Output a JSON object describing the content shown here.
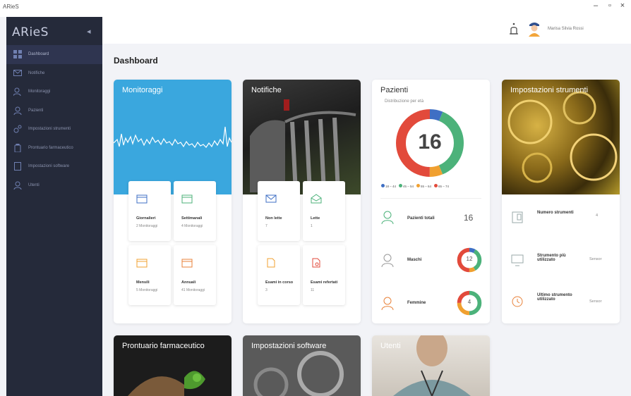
{
  "window": {
    "title": "ARieS",
    "minimize": "–",
    "maximize": "▫",
    "close": "×"
  },
  "sidebar": {
    "brand": "ARieS",
    "collapse": "◂",
    "items": [
      {
        "label": "Dashboard"
      },
      {
        "label": "Notifiche"
      },
      {
        "label": "Monitoraggi"
      },
      {
        "label": "Pazienti"
      },
      {
        "label": "Impostazioni strumenti"
      },
      {
        "label": "Prontuario farmaceutico"
      },
      {
        "label": "Impostazioni software"
      },
      {
        "label": "Utenti"
      }
    ]
  },
  "header": {
    "username": "Marisa Silvia Rossi"
  },
  "page": {
    "title": "Dashboard"
  },
  "cards": {
    "monitoraggi": {
      "title": "Monitoraggi",
      "tiles": [
        {
          "name": "Giornalieri",
          "sub": "2 Monitoraggi"
        },
        {
          "name": "Settimanali",
          "sub": "4 Monitoraggi"
        },
        {
          "name": "Mensili",
          "sub": "5 Monitoraggi"
        },
        {
          "name": "Annuali",
          "sub": "41 Monitoraggi"
        }
      ]
    },
    "notifiche": {
      "title": "Notifiche",
      "tiles": [
        {
          "name": "Non lette",
          "sub": "7"
        },
        {
          "name": "Lette",
          "sub": "1"
        },
        {
          "name": "Esami in corso",
          "sub": "3"
        },
        {
          "name": "Esami refertati",
          "sub": "11"
        }
      ]
    },
    "pazienti": {
      "title": "Pazienti",
      "subtitle": "Distribuzione per età",
      "total_center": "16",
      "legend": [
        "18 – 44",
        "45 – 54",
        "55 – 64",
        "65 – 74"
      ],
      "rows": [
        {
          "label": "Pazienti totali",
          "value": "16"
        },
        {
          "label": "Maschi",
          "value": "12"
        },
        {
          "label": "Femmine",
          "value": "4"
        }
      ]
    },
    "strumenti": {
      "title": "Impostazioni strumenti",
      "rows": [
        {
          "label": "Numero strumenti",
          "value": "4"
        },
        {
          "label": "Strumento più utilizzato",
          "value": "Sensor"
        },
        {
          "label": "Ultimo strumento utilizzato",
          "value": "Sensor"
        }
      ]
    },
    "prontuario": {
      "title": "Prontuario farmaceutico"
    },
    "software": {
      "title": "Impostazioni software"
    },
    "utenti": {
      "title": "Utenti"
    }
  },
  "chart_data": [
    {
      "type": "pie",
      "title": "Distribuzione per età",
      "categories": [
        "18 – 44",
        "45 – 54",
        "55 – 64",
        "65 – 74"
      ],
      "values": [
        1,
        6,
        1,
        8
      ],
      "colors": [
        "#3f6fc4",
        "#4cb27a",
        "#f0a030",
        "#e24a3b"
      ]
    },
    {
      "type": "pie",
      "title": "Maschi",
      "categories": [
        "18 – 44",
        "45 – 54",
        "55 – 64",
        "65 – 74"
      ],
      "values": [
        1,
        4,
        1,
        6
      ],
      "colors": [
        "#3f6fc4",
        "#4cb27a",
        "#f0a030",
        "#e24a3b"
      ]
    },
    {
      "type": "pie",
      "title": "Femmine",
      "categories": [
        "18 – 44",
        "45 – 54",
        "55 – 64",
        "65 – 74"
      ],
      "values": [
        0,
        2,
        1,
        1
      ],
      "colors": [
        "#3f6fc4",
        "#4cb27a",
        "#f0a030",
        "#e24a3b"
      ]
    }
  ]
}
